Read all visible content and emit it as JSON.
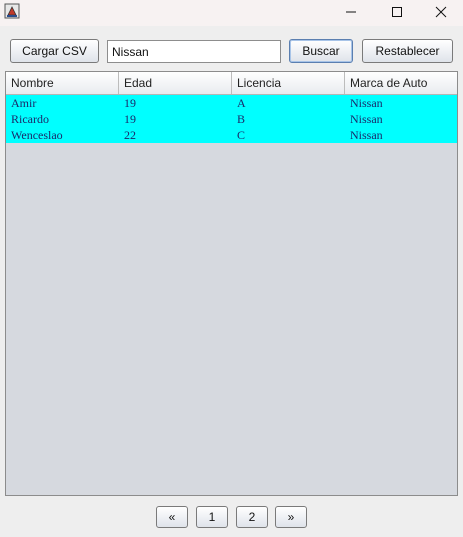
{
  "window": {
    "icon": "java-app-icon",
    "controls": [
      "minimize-icon",
      "maximize-icon",
      "close-icon"
    ]
  },
  "toolbar": {
    "load_label": "Cargar CSV",
    "search_value": "Nissan",
    "search_label": "Buscar",
    "reset_label": "Restablecer"
  },
  "table": {
    "columns": [
      "Nombre",
      "Edad",
      "Licencia",
      "Marca de Auto"
    ],
    "rows": [
      [
        "Amir",
        "19",
        "A",
        "Nissan"
      ],
      [
        "Ricardo",
        "19",
        "B",
        "Nissan"
      ],
      [
        "Wenceslao",
        "22",
        "C",
        "Nissan"
      ]
    ],
    "highlight_color": "#00ffff"
  },
  "pagination": {
    "prev_label": "«",
    "pages": [
      "1",
      "2"
    ],
    "next_label": "»"
  }
}
